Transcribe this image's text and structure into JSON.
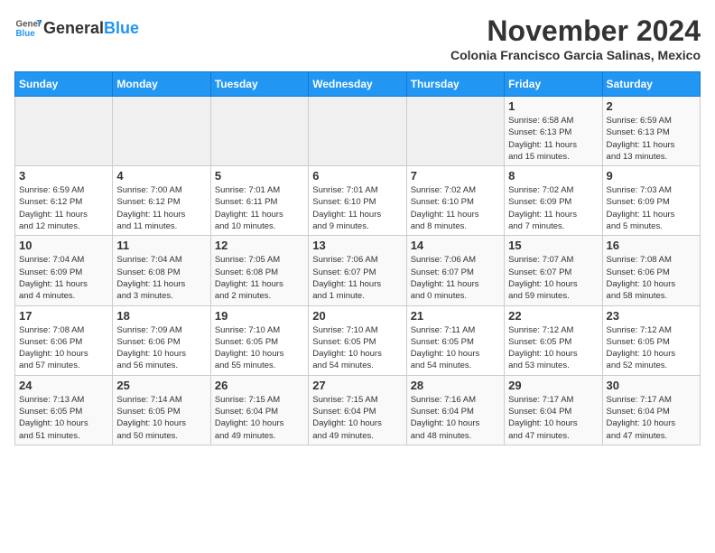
{
  "logo": {
    "general": "General",
    "blue": "Blue"
  },
  "title": "November 2024",
  "location": "Colonia Francisco Garcia Salinas, Mexico",
  "weekdays": [
    "Sunday",
    "Monday",
    "Tuesday",
    "Wednesday",
    "Thursday",
    "Friday",
    "Saturday"
  ],
  "weeks": [
    [
      {
        "day": "",
        "info": ""
      },
      {
        "day": "",
        "info": ""
      },
      {
        "day": "",
        "info": ""
      },
      {
        "day": "",
        "info": ""
      },
      {
        "day": "",
        "info": ""
      },
      {
        "day": "1",
        "info": "Sunrise: 6:58 AM\nSunset: 6:13 PM\nDaylight: 11 hours\nand 15 minutes."
      },
      {
        "day": "2",
        "info": "Sunrise: 6:59 AM\nSunset: 6:13 PM\nDaylight: 11 hours\nand 13 minutes."
      }
    ],
    [
      {
        "day": "3",
        "info": "Sunrise: 6:59 AM\nSunset: 6:12 PM\nDaylight: 11 hours\nand 12 minutes."
      },
      {
        "day": "4",
        "info": "Sunrise: 7:00 AM\nSunset: 6:12 PM\nDaylight: 11 hours\nand 11 minutes."
      },
      {
        "day": "5",
        "info": "Sunrise: 7:01 AM\nSunset: 6:11 PM\nDaylight: 11 hours\nand 10 minutes."
      },
      {
        "day": "6",
        "info": "Sunrise: 7:01 AM\nSunset: 6:10 PM\nDaylight: 11 hours\nand 9 minutes."
      },
      {
        "day": "7",
        "info": "Sunrise: 7:02 AM\nSunset: 6:10 PM\nDaylight: 11 hours\nand 8 minutes."
      },
      {
        "day": "8",
        "info": "Sunrise: 7:02 AM\nSunset: 6:09 PM\nDaylight: 11 hours\nand 7 minutes."
      },
      {
        "day": "9",
        "info": "Sunrise: 7:03 AM\nSunset: 6:09 PM\nDaylight: 11 hours\nand 5 minutes."
      }
    ],
    [
      {
        "day": "10",
        "info": "Sunrise: 7:04 AM\nSunset: 6:09 PM\nDaylight: 11 hours\nand 4 minutes."
      },
      {
        "day": "11",
        "info": "Sunrise: 7:04 AM\nSunset: 6:08 PM\nDaylight: 11 hours\nand 3 minutes."
      },
      {
        "day": "12",
        "info": "Sunrise: 7:05 AM\nSunset: 6:08 PM\nDaylight: 11 hours\nand 2 minutes."
      },
      {
        "day": "13",
        "info": "Sunrise: 7:06 AM\nSunset: 6:07 PM\nDaylight: 11 hours\nand 1 minute."
      },
      {
        "day": "14",
        "info": "Sunrise: 7:06 AM\nSunset: 6:07 PM\nDaylight: 11 hours\nand 0 minutes."
      },
      {
        "day": "15",
        "info": "Sunrise: 7:07 AM\nSunset: 6:07 PM\nDaylight: 10 hours\nand 59 minutes."
      },
      {
        "day": "16",
        "info": "Sunrise: 7:08 AM\nSunset: 6:06 PM\nDaylight: 10 hours\nand 58 minutes."
      }
    ],
    [
      {
        "day": "17",
        "info": "Sunrise: 7:08 AM\nSunset: 6:06 PM\nDaylight: 10 hours\nand 57 minutes."
      },
      {
        "day": "18",
        "info": "Sunrise: 7:09 AM\nSunset: 6:06 PM\nDaylight: 10 hours\nand 56 minutes."
      },
      {
        "day": "19",
        "info": "Sunrise: 7:10 AM\nSunset: 6:05 PM\nDaylight: 10 hours\nand 55 minutes."
      },
      {
        "day": "20",
        "info": "Sunrise: 7:10 AM\nSunset: 6:05 PM\nDaylight: 10 hours\nand 54 minutes."
      },
      {
        "day": "21",
        "info": "Sunrise: 7:11 AM\nSunset: 6:05 PM\nDaylight: 10 hours\nand 54 minutes."
      },
      {
        "day": "22",
        "info": "Sunrise: 7:12 AM\nSunset: 6:05 PM\nDaylight: 10 hours\nand 53 minutes."
      },
      {
        "day": "23",
        "info": "Sunrise: 7:12 AM\nSunset: 6:05 PM\nDaylight: 10 hours\nand 52 minutes."
      }
    ],
    [
      {
        "day": "24",
        "info": "Sunrise: 7:13 AM\nSunset: 6:05 PM\nDaylight: 10 hours\nand 51 minutes."
      },
      {
        "day": "25",
        "info": "Sunrise: 7:14 AM\nSunset: 6:05 PM\nDaylight: 10 hours\nand 50 minutes."
      },
      {
        "day": "26",
        "info": "Sunrise: 7:15 AM\nSunset: 6:04 PM\nDaylight: 10 hours\nand 49 minutes."
      },
      {
        "day": "27",
        "info": "Sunrise: 7:15 AM\nSunset: 6:04 PM\nDaylight: 10 hours\nand 49 minutes."
      },
      {
        "day": "28",
        "info": "Sunrise: 7:16 AM\nSunset: 6:04 PM\nDaylight: 10 hours\nand 48 minutes."
      },
      {
        "day": "29",
        "info": "Sunrise: 7:17 AM\nSunset: 6:04 PM\nDaylight: 10 hours\nand 47 minutes."
      },
      {
        "day": "30",
        "info": "Sunrise: 7:17 AM\nSunset: 6:04 PM\nDaylight: 10 hours\nand 47 minutes."
      }
    ]
  ]
}
